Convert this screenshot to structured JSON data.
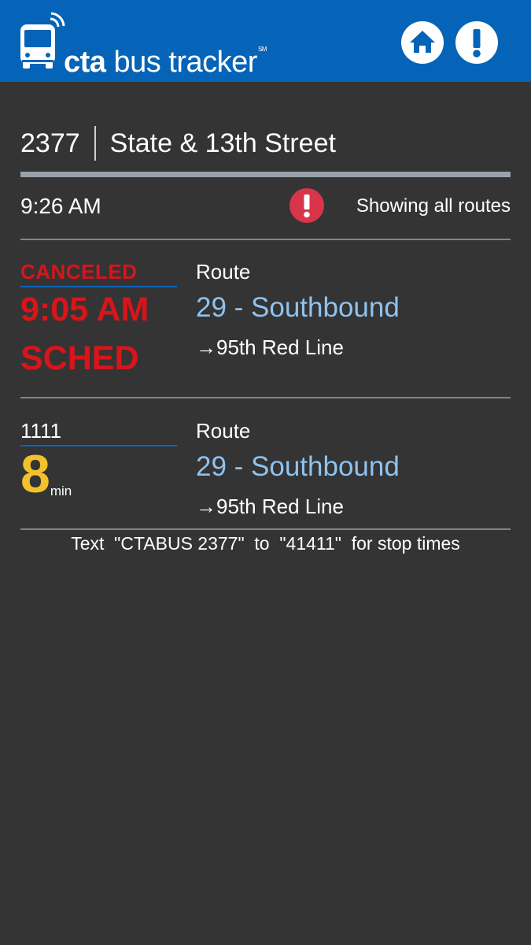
{
  "header": {
    "logo_text_bold": "cta",
    "logo_text_rest": " bus tracker",
    "logo_mark": "SM",
    "logo_icon": "bus-wifi-icon",
    "home_icon": "home-icon",
    "alert_icon": "exclamation-icon",
    "brand_color": "#0664b8"
  },
  "stop": {
    "id": "2377",
    "name": "State & 13th Street"
  },
  "status": {
    "current_time": "9:26 AM",
    "warning_icon": "exclamation-circle-icon",
    "filter_text": "Showing all routes"
  },
  "predictions": [
    {
      "label": "CANCELED",
      "sched_time": "9:05 AM",
      "sched_word": "SCHED",
      "route_label": "Route",
      "route_name": "29 - Southbound",
      "destination": "→95th Red Line"
    },
    {
      "label": "1111",
      "eta_value": "8",
      "eta_unit": "min",
      "route_label": "Route",
      "route_name": "29 - Southbound",
      "destination": "→95th Red Line"
    }
  ],
  "footer": {
    "sms_text": "Text  \"CTABUS 2377\"  to  \"41411\"  for stop times"
  },
  "colors": {
    "background": "#343434",
    "canceled": "#d9141b",
    "eta": "#f3c22b",
    "route_link": "#8fc3ef",
    "warning": "#d8344a"
  }
}
